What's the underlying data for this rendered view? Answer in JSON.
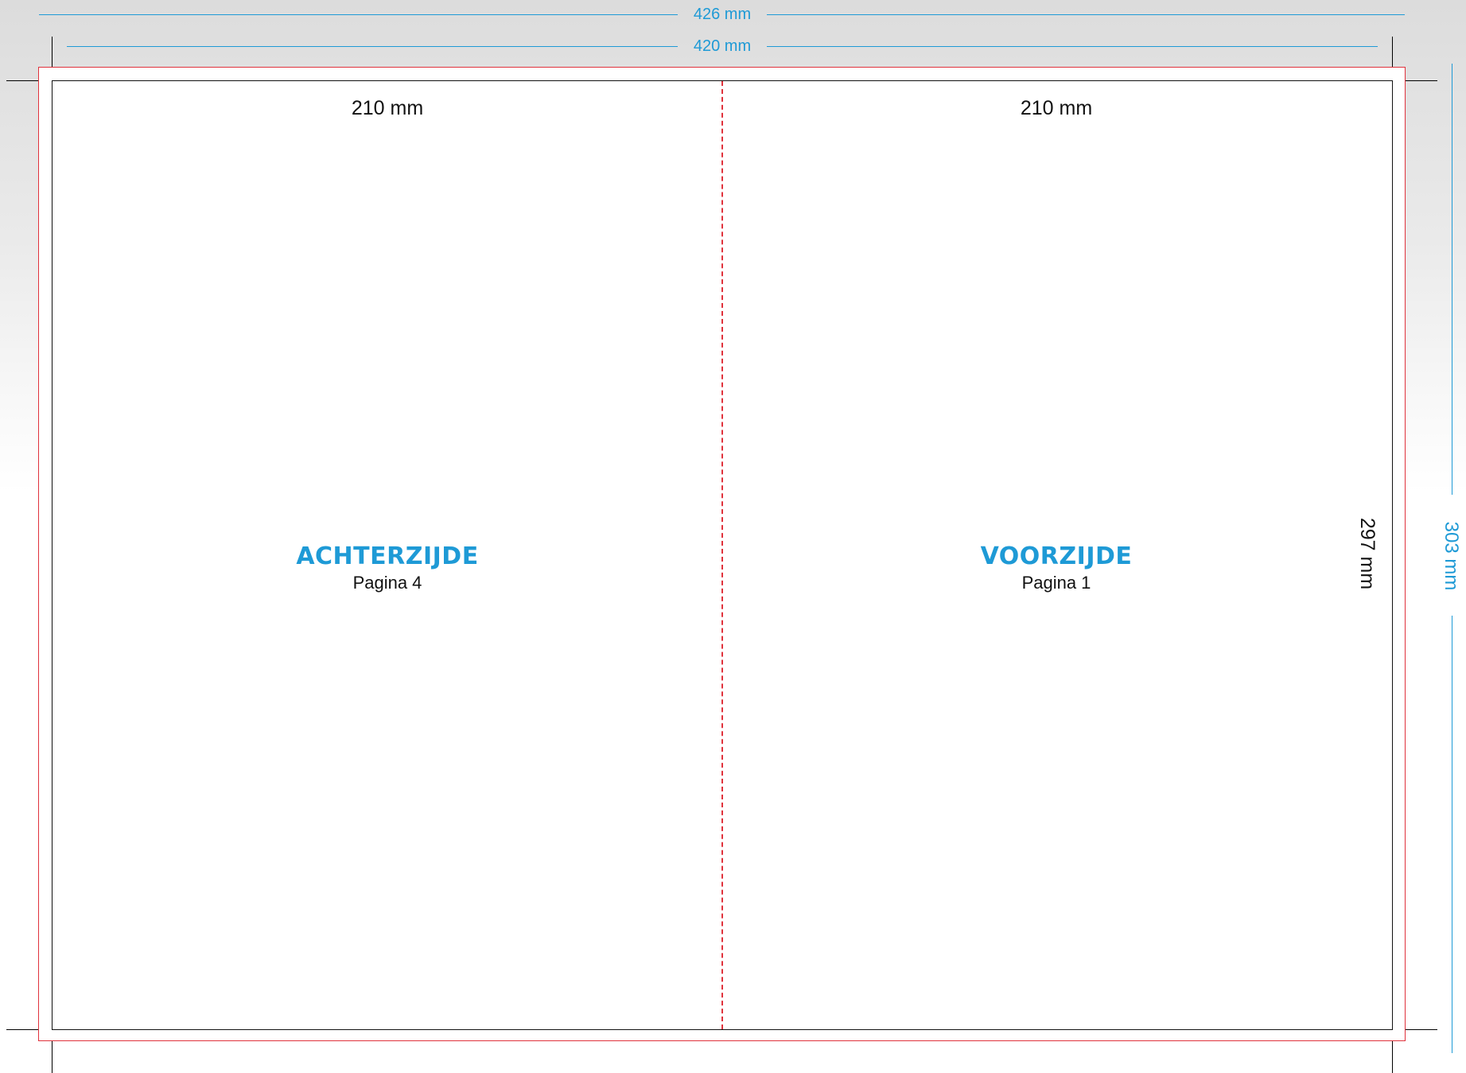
{
  "dimensions": {
    "bleed_width": "426 mm",
    "trim_width": "420 mm",
    "left_panel_width": "210 mm",
    "right_panel_width": "210 mm",
    "trim_height": "297 mm",
    "bleed_height": "303 mm"
  },
  "panels": {
    "back": {
      "title": "ACHTERZIJDE",
      "subtitle": "Pagina 4"
    },
    "front": {
      "title": "VOORZIJDE",
      "subtitle": "Pagina 1"
    }
  },
  "colors": {
    "accent": "#1e9ad6",
    "bleed_line": "#e0323c",
    "fold_line": "#e0323c",
    "trim_line": "#000000"
  }
}
